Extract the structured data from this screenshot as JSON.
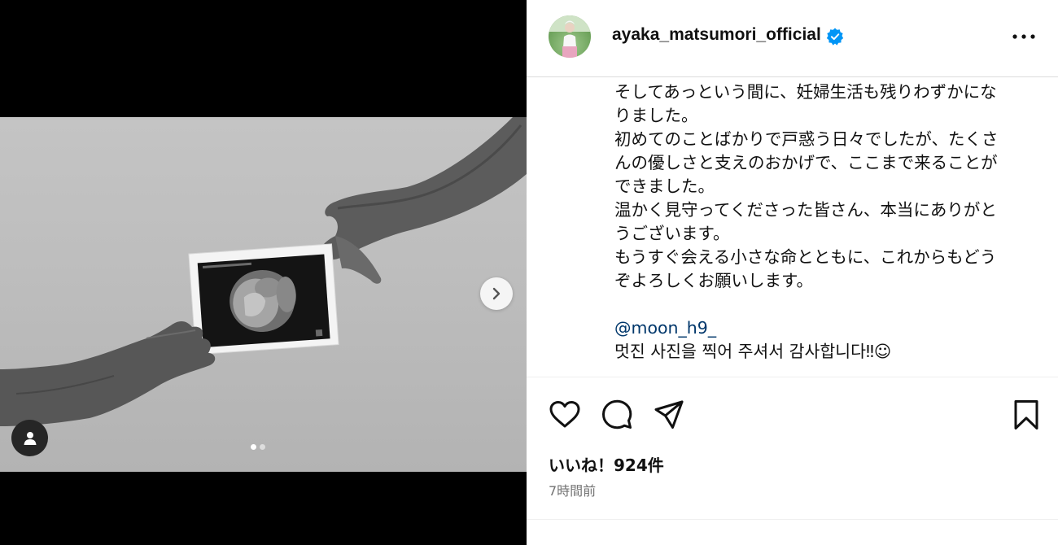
{
  "post": {
    "username": "ayaka_matsumori_official",
    "caption_lines": [
      "そしてあっという間に、妊婦生活も残りわずかにな",
      "りました。",
      "初めてのことばかりで戸惑う日々でしたが、たくさ",
      "んの優しさと支えのおかげで、ここまで来ることが",
      "できました。",
      "温かく見守ってくださった皆さん、本当にありがと",
      "うございます。",
      "もうすぐ会える小さな命とともに、これからもどう",
      "ぞよろしくお願いします。"
    ],
    "mention": "@moon_h9_",
    "thanks": "멋진 사진을 찍어 주셔서 감사합니다‼☺",
    "likes": "いいね！924件",
    "time": "7時間前"
  },
  "carousel": {
    "slide_count": 2,
    "active_slide": 1
  },
  "colors": {
    "verified": "#0095f6",
    "link": "#00376b",
    "muted": "#737373"
  },
  "icons": [
    "heart-icon",
    "comment-icon",
    "share-icon",
    "save-icon",
    "more-icon",
    "verified-icon",
    "chevron-right-icon",
    "user-tag-icon"
  ]
}
